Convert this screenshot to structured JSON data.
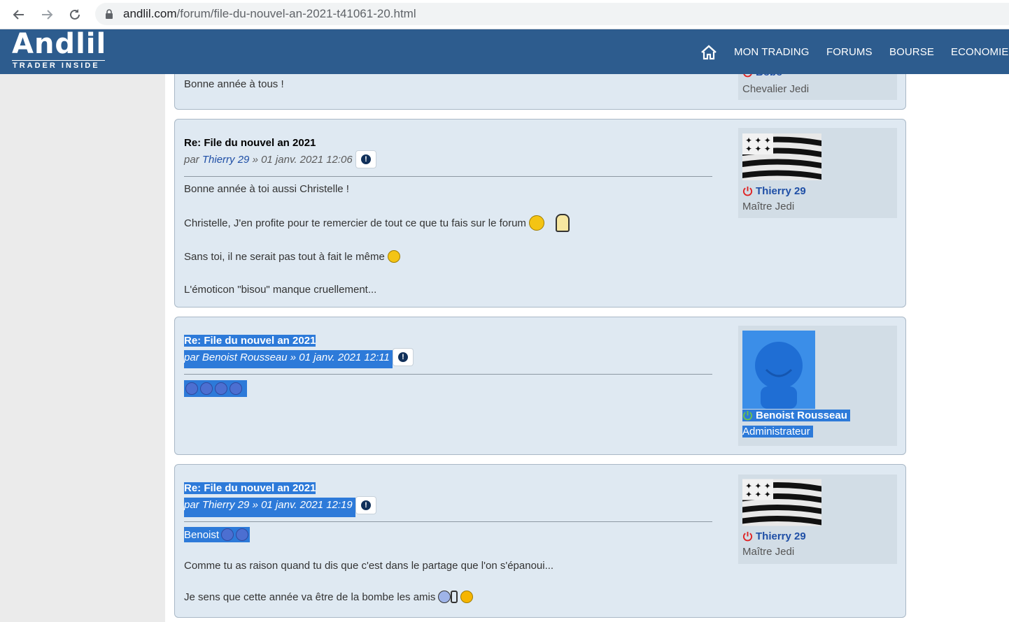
{
  "browser": {
    "url_domain": "andlil.com",
    "url_path": "/forum/file-du-nouvel-an-2021-t41061-20.html"
  },
  "header": {
    "logo_text": "Andlil",
    "logo_tagline": "TRADER INSIDE",
    "nav": [
      "MON TRADING",
      "FORUMS",
      "BOURSE",
      "ECONOMIE"
    ]
  },
  "posts": [
    {
      "text_lines": [
        "Bonne année à tous !"
      ],
      "author_name": "Bobo",
      "author_rank": "Chevalier Jedi"
    },
    {
      "title": "Re: File du nouvel an 2021",
      "meta_prefix": "par",
      "author": "Thierry 29",
      "date": "» 01 janv. 2021 12:06",
      "text_lines": [
        "Bonne année à toi aussi Christelle !",
        "Christelle, J'en profite pour te remercier de tout ce que tu fais sur le forum",
        "Sans toi, il ne serait pas tout à fait le même",
        "L'émoticon \"bisou\" manque cruellement..."
      ],
      "author_name": "Thierry 29",
      "author_rank": "Maître Jedi"
    },
    {
      "title": "Re: File du nouvel an 2021",
      "meta_prefix": "par",
      "author": "Benoist Rousseau",
      "date": "» 01 janv. 2021 12:11",
      "author_name": "Benoist Rousseau",
      "author_rank": "Administrateur"
    },
    {
      "title": "Re: File du nouvel an 2021",
      "meta_prefix": "par",
      "author": "Thierry 29",
      "date": "» 01 janv. 2021 12:19",
      "text_lines": [
        "Benoist",
        "Comme tu as raison quand tu dis que c'est dans le partage que l'on s'épanoui...",
        "Je sens que cette année va être de la bombe les amis"
      ],
      "author_name": "Thierry 29",
      "author_rank": "Maître Jedi"
    }
  ],
  "colors": {
    "header_bg": "#2d5c8e",
    "post_bg": "#dfe9f2",
    "selection": "#2d7ad9",
    "link": "#1f4fa6",
    "offline": "#e02020",
    "online": "#6cc24a"
  }
}
